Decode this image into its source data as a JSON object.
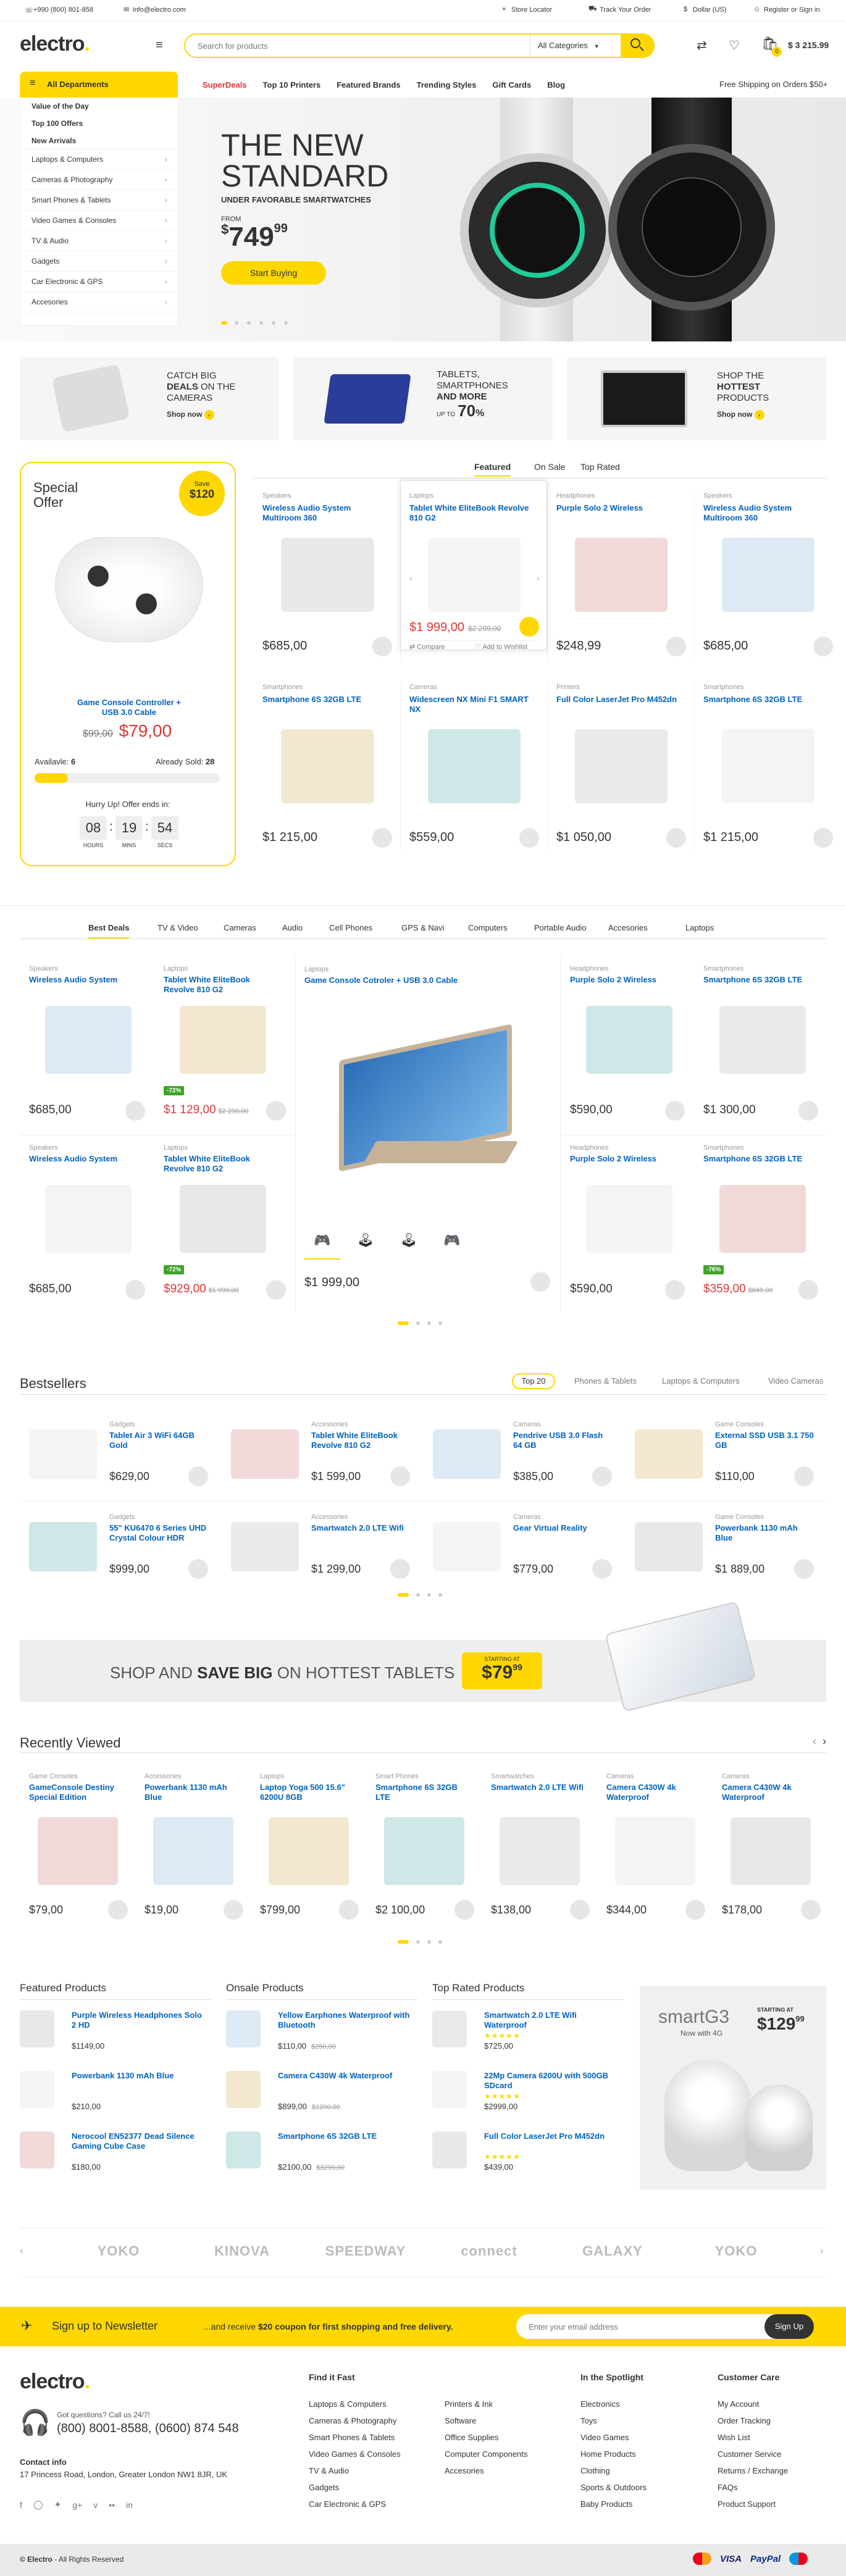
{
  "topbar": {
    "phone": "+990 (800) 801-858",
    "email": "info@electro.com",
    "store": "Store Locator",
    "track": "Track Your Order",
    "currency": "Dollar (US)",
    "account": "Register or Sign in"
  },
  "header": {
    "logo": "electro",
    "logo_dot": ".",
    "search_placeholder": "Search for products",
    "search_cat": "All Categories",
    "cart_count": "0",
    "cart_total": "$ 3 215.99"
  },
  "nav": {
    "departments": "All Departments",
    "items": [
      "SuperDeals",
      "Top 10 Printers",
      "Featured Brands",
      "Trending Styles",
      "Gift Cards",
      "Blog"
    ],
    "shipping": "Free Shipping on Orders $50+"
  },
  "sidebar": {
    "bold": [
      "Value of the Day",
      "Top 100 Offers",
      "New Arrivals"
    ],
    "items": [
      "Laptops & Computers",
      "Cameras & Photography",
      "Smart Phones & Tablets",
      "Video Games & Consoles",
      "TV & Audio",
      "Gadgets",
      "Car Electronic & GPS",
      "Accesories"
    ]
  },
  "hero": {
    "line1": "THE NEW",
    "line2": "STANDARD",
    "sub": "UNDER FAVORABLE SMARTWATCHES",
    "from": "FROM",
    "price_dollar": "$",
    "price_int": "749",
    "price_dec": "99",
    "cta": "Start Buying"
  },
  "promos": [
    {
      "l1": "CATCH BIG",
      "l2": "DEALS",
      "l3": "ON THE",
      "l4": "CAMERAS",
      "link": "Shop now"
    },
    {
      "l1": "TABLETS,",
      "l2": "SMARTPHONES",
      "l3": "AND MORE",
      "l4": "UP TO",
      "pct": "70",
      "link": ""
    },
    {
      "l1": "SHOP THE",
      "l2": "HOTTEST",
      "l3": "PRODUCTS",
      "l4": "",
      "link": "Shop now"
    }
  ],
  "special": {
    "title1": "Special",
    "title2": "Offer",
    "save": "Save",
    "save_amt": "$120",
    "name": "Game Console Controller + USB 3.0 Cable",
    "old": "$99,00",
    "price": "$79,00",
    "avail_label": "Availavle:",
    "avail": "6",
    "sold_label": "Already Sold:",
    "sold": "28",
    "progress": 0.18,
    "hurry": "Hurry Up! Offer ends in:",
    "h": "08",
    "m": "19",
    "s": "54",
    "hl": "HOURS",
    "ml": "MINS",
    "sl": "SECS"
  },
  "feat_tabs": [
    "Featured",
    "On Sale",
    "Top Rated"
  ],
  "featured": [
    {
      "cat": "Speakers",
      "name": "Wireless Audio System Multiroom 360",
      "price": "$685,00",
      "old": ""
    },
    {
      "cat": "Laptops",
      "name": "Tablet White EliteBook Revolve 810 G2",
      "price": "$1 999,00",
      "old": "$2 299,00",
      "compare": "Compare",
      "wish": "Add to Wishlist"
    },
    {
      "cat": "Headphones",
      "name": "Purple Solo 2 Wireless",
      "price": "$248,99",
      "old": ""
    },
    {
      "cat": "Speakers",
      "name": "Wireless Audio System Multiroom 360",
      "price": "$685,00",
      "old": ""
    },
    {
      "cat": "Smartphones",
      "name": "Smartphone 6S 32GB LTE",
      "price": "$1 215,00",
      "old": ""
    },
    {
      "cat": "Cameras",
      "name": "Widescreen NX Mini F1 SMART NX",
      "price": "$559,00",
      "old": ""
    },
    {
      "cat": "Printers",
      "name": "Full Color LaserJet Pro M452dn",
      "price": "$1 050,00",
      "old": ""
    },
    {
      "cat": "Smartphones",
      "name": "Smartphone 6S 32GB LTE",
      "price": "$1 215,00",
      "old": ""
    }
  ],
  "deal_tabs": [
    "Best Deals",
    "TV & Video",
    "Cameras",
    "Audio",
    "Cell Phones",
    "GPS & Navi",
    "Computers",
    "Portable Audio",
    "Accesories",
    "Laptops"
  ],
  "deals": [
    {
      "cat": "Speakers",
      "name": "Wireless Audio System",
      "price": "$685,00",
      "old": "",
      "badge": ""
    },
    {
      "cat": "Laptops",
      "name": "Tablet White EliteBook Revolve 810 G2",
      "price": "$1 129,00",
      "old": "$2 299,00",
      "badge": "-72%"
    },
    {
      "cat": "Headphones",
      "name": "Purple Solo 2 Wireless",
      "price": "$590,00",
      "old": "",
      "badge": ""
    },
    {
      "cat": "Smartphones",
      "name": "Smartphone 6S 32GB LTE",
      "price": "$1 300,00",
      "old": "",
      "badge": ""
    },
    {
      "cat": "Speakers",
      "name": "Wireless Audio System",
      "price": "$685,00",
      "old": "",
      "badge": ""
    },
    {
      "cat": "Laptops",
      "name": "Tablet White EliteBook Revolve 810 G2",
      "price": "$929,00",
      "old": "$1 999,00",
      "badge": "-72%"
    },
    {
      "cat": "Headphones",
      "name": "Purple Solo 2 Wireless",
      "price": "$590,00",
      "old": "",
      "badge": ""
    },
    {
      "cat": "Smartphones",
      "name": "Smartphone 6S 32GB LTE",
      "price": "$359,00",
      "old": "$849,00",
      "badge": "-76%"
    }
  ],
  "deal_big": {
    "cat": "Laptops",
    "name": "Game Console Cotroler + USB 3.0 Cable",
    "price": "$1 999,00"
  },
  "bestsellers": {
    "title": "Bestsellers",
    "tabs": [
      "Top 20",
      "Phones & Tablets",
      "Laptops & Computers",
      "Video Cameras"
    ],
    "items": [
      {
        "cat": "Gadgets",
        "name": "Tablet Air 3 WiFi 64GB Gold",
        "price": "$629,00"
      },
      {
        "cat": "Accessories",
        "name": "Tablet White EliteBook Revolve 810 G2",
        "price": "$1 599,00"
      },
      {
        "cat": "Cameras",
        "name": "Pendrive USB 3.0 Flash 64 GB",
        "price": "$385,00"
      },
      {
        "cat": "Game Consoles",
        "name": "External SSD USB 3.1 750 GB",
        "price": "$110,00"
      },
      {
        "cat": "Gadgets",
        "name": "55\" KU6470 6 Series UHD Crystal Colour HDR",
        "price": "$999,00"
      },
      {
        "cat": "Accessories",
        "name": "Smartwatch 2.0 LTE Wifi",
        "price": "$1 299,00"
      },
      {
        "cat": "Cameras",
        "name": "Gear Virtual Reality",
        "price": "$779,00"
      },
      {
        "cat": "Game Consoles",
        "name": "Powerbank 1130 mAh Blue",
        "price": "$1 889,00"
      }
    ]
  },
  "banner": {
    "pre": "SHOP AND",
    "bold": "SAVE BIG",
    "post": "ON HOTTEST TABLETS",
    "starting": "STARTING AT",
    "price": "$79",
    "dec": "99"
  },
  "recent": {
    "title": "Recently Viewed",
    "items": [
      {
        "cat": "Game Consoles",
        "name": "GameConsole Destiny Special Edition",
        "price": "$79,00"
      },
      {
        "cat": "Accessories",
        "name": "Powerbank 1130 mAh Blue",
        "price": "$19,00"
      },
      {
        "cat": "Laptops",
        "name": "Laptop Yoga 500 15.6\" 6200U 8GB",
        "price": "$799,00"
      },
      {
        "cat": "Smart Phones",
        "name": "Smartphone 6S 32GB LTE",
        "price": "$2 100,00"
      },
      {
        "cat": "Smartwatches",
        "name": "Smartwatch 2.0 LTE Wifi",
        "price": "$138,00"
      },
      {
        "cat": "Cameras",
        "name": "Camera C430W 4k Waterproof",
        "price": "$344,00"
      },
      {
        "cat": "Cameras",
        "name": "Camera C430W 4k Waterproof",
        "price": "$178,00"
      }
    ]
  },
  "lists": [
    {
      "title": "Featured Products",
      "items": [
        {
          "name": "Purple Wireless Headphones Solo 2 HD",
          "price": "$1149,00",
          "old": ""
        },
        {
          "name": "Powerbank 1130 mAh Blue",
          "price": "$210,00",
          "old": ""
        },
        {
          "name": "Nerocool EN52377 Dead Silence Gaming Cube Case",
          "price": "$180,00",
          "old": ""
        }
      ]
    },
    {
      "title": "Onsale Products",
      "items": [
        {
          "name": "Yellow Earphones Waterproof with Bluetooth",
          "price": "$110,00",
          "old": "$250,00"
        },
        {
          "name": "Camera C430W 4k Waterproof",
          "price": "$899,00",
          "old": "$1200,00"
        },
        {
          "name": "Smartphone 6S 32GB LTE",
          "price": "$2100,00",
          "old": "$3299,00"
        }
      ]
    },
    {
      "title": "Top Rated Products",
      "items": [
        {
          "name": "Smartwatch 2.0 LTE Wifi Waterproof",
          "price": "$725,00",
          "old": ""
        },
        {
          "name": "22Mp Camera 6200U with 500GB SDcard",
          "price": "$2999,00",
          "old": ""
        },
        {
          "name": "Full Color LaserJet Pro M452dn",
          "price": "$439,00",
          "old": ""
        }
      ]
    }
  ],
  "ad": {
    "title": "smartG3",
    "sub": "Now with 4G",
    "starting": "STARTING AT",
    "price": "$129",
    "dec": "99"
  },
  "brands": [
    "YOKO",
    "KINOVA",
    "SPEEDWAY",
    "connect",
    "GALAXY",
    "YOKO"
  ],
  "newsletter": {
    "title": "Sign up to Newsletter",
    "text_pre": "...and receive ",
    "text_bold": "$20 coupon for first shopping and free delivery.",
    "placeholder": "Enter your email address",
    "button": "Sign Up"
  },
  "footer": {
    "logo": "electro",
    "q": "Got questions? Call us 24/7!",
    "phone": "(800) 8001-8588, (0600) 874 548",
    "contact_label": "Contact info",
    "address": "17 Princess Road, London, Greater London NW1 8JR, UK",
    "col1_title": "Find it Fast",
    "col1": [
      "Laptops & Computers",
      "Cameras & Photography",
      "Smart Phones & Tablets",
      "Video Games & Consoles",
      "TV & Audio",
      "Gadgets",
      "Car Electronic & GPS"
    ],
    "col2": [
      "Printers & Ink",
      "Software",
      "Office Supplies",
      "Computer Components",
      "Accesories"
    ],
    "col3_title": "In the Spotlight",
    "col3": [
      "Electronics",
      "Toys",
      "Video Games",
      "Home Products",
      "Clothing",
      "Sports & Outdoors",
      "Baby Products"
    ],
    "col4_title": "Customer Care",
    "col4": [
      "My Account",
      "Order Tracking",
      "Wish List",
      "Customer Service",
      "Returns / Exchange",
      "FAQs",
      "Product Support"
    ],
    "copyright_bold": "© Electro",
    "copyright": " - All Rights Reserved",
    "payments": [
      "VISA",
      "PayPal"
    ]
  },
  "colors": {
    "accent": "#fed700",
    "link": "#0062bd",
    "sale": "#df3737"
  }
}
